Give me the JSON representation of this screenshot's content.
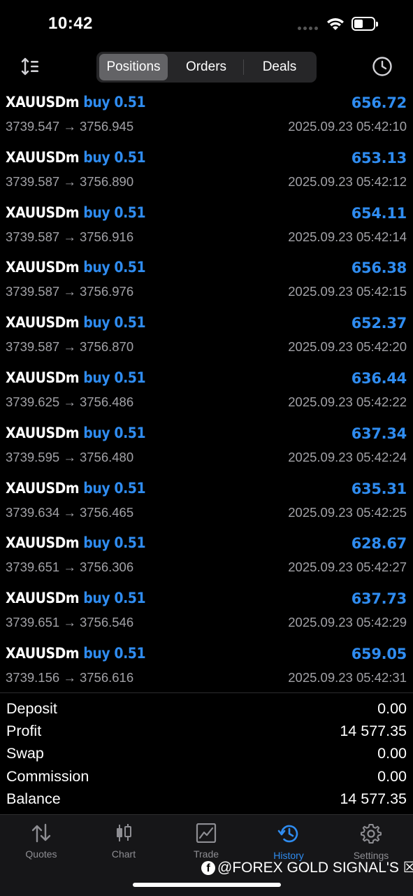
{
  "status_bar": {
    "time": "10:42"
  },
  "toolbar": {
    "tabs": [
      {
        "label": "Positions",
        "active": true
      },
      {
        "label": "Orders",
        "active": false
      },
      {
        "label": "Deals",
        "active": false
      }
    ],
    "left_icon": "sort-icon",
    "right_icon": "history-clock-icon"
  },
  "deals": [
    {
      "symbol": "XAUUSDm",
      "side": "buy 0.51",
      "profit": "656.72",
      "open_price": "3739.547",
      "arrow": "→",
      "close_price": "3756.945",
      "time": "2025.09.23 05:42:10"
    },
    {
      "symbol": "XAUUSDm",
      "side": "buy 0.51",
      "profit": "653.13",
      "open_price": "3739.587",
      "arrow": "→",
      "close_price": "3756.890",
      "time": "2025.09.23 05:42:12"
    },
    {
      "symbol": "XAUUSDm",
      "side": "buy 0.51",
      "profit": "654.11",
      "open_price": "3739.587",
      "arrow": "→",
      "close_price": "3756.916",
      "time": "2025.09.23 05:42:14"
    },
    {
      "symbol": "XAUUSDm",
      "side": "buy 0.51",
      "profit": "656.38",
      "open_price": "3739.587",
      "arrow": "→",
      "close_price": "3756.976",
      "time": "2025.09.23 05:42:15"
    },
    {
      "symbol": "XAUUSDm",
      "side": "buy 0.51",
      "profit": "652.37",
      "open_price": "3739.587",
      "arrow": "→",
      "close_price": "3756.870",
      "time": "2025.09.23 05:42:20"
    },
    {
      "symbol": "XAUUSDm",
      "side": "buy 0.51",
      "profit": "636.44",
      "open_price": "3739.625",
      "arrow": "→",
      "close_price": "3756.486",
      "time": "2025.09.23 05:42:22"
    },
    {
      "symbol": "XAUUSDm",
      "side": "buy 0.51",
      "profit": "637.34",
      "open_price": "3739.595",
      "arrow": "→",
      "close_price": "3756.480",
      "time": "2025.09.23 05:42:24"
    },
    {
      "symbol": "XAUUSDm",
      "side": "buy 0.51",
      "profit": "635.31",
      "open_price": "3739.634",
      "arrow": "→",
      "close_price": "3756.465",
      "time": "2025.09.23 05:42:25"
    },
    {
      "symbol": "XAUUSDm",
      "side": "buy 0.51",
      "profit": "628.67",
      "open_price": "3739.651",
      "arrow": "→",
      "close_price": "3756.306",
      "time": "2025.09.23 05:42:27"
    },
    {
      "symbol": "XAUUSDm",
      "side": "buy 0.51",
      "profit": "637.73",
      "open_price": "3739.651",
      "arrow": "→",
      "close_price": "3756.546",
      "time": "2025.09.23 05:42:29"
    },
    {
      "symbol": "XAUUSDm",
      "side": "buy 0.51",
      "profit": "659.05",
      "open_price": "3739.156",
      "arrow": "→",
      "close_price": "3756.616",
      "time": "2025.09.23 05:42:31"
    }
  ],
  "summary": [
    {
      "label": "Deposit",
      "value": "0.00"
    },
    {
      "label": "Profit",
      "value": "14 577.35"
    },
    {
      "label": "Swap",
      "value": "0.00"
    },
    {
      "label": "Commission",
      "value": "0.00"
    },
    {
      "label": "Balance",
      "value": "14 577.35"
    }
  ],
  "tabbar": [
    {
      "label": "Quotes",
      "icon": "quotes-arrows-icon",
      "active": false
    },
    {
      "label": "Chart",
      "icon": "candlestick-chart-icon",
      "active": false
    },
    {
      "label": "Trade",
      "icon": "trade-chart-icon",
      "active": false
    },
    {
      "label": "History",
      "icon": "history-clock-icon",
      "active": true
    },
    {
      "label": "Settings",
      "icon": "gear-icon",
      "active": false
    }
  ],
  "watermark": {
    "text": "@FOREX GOLD SIGNAL'S ☒",
    "icon": "facebook-icon"
  },
  "colors": {
    "accent": "#2f8cf0",
    "background": "#000000",
    "secondary_text": "#a1a1a6"
  }
}
